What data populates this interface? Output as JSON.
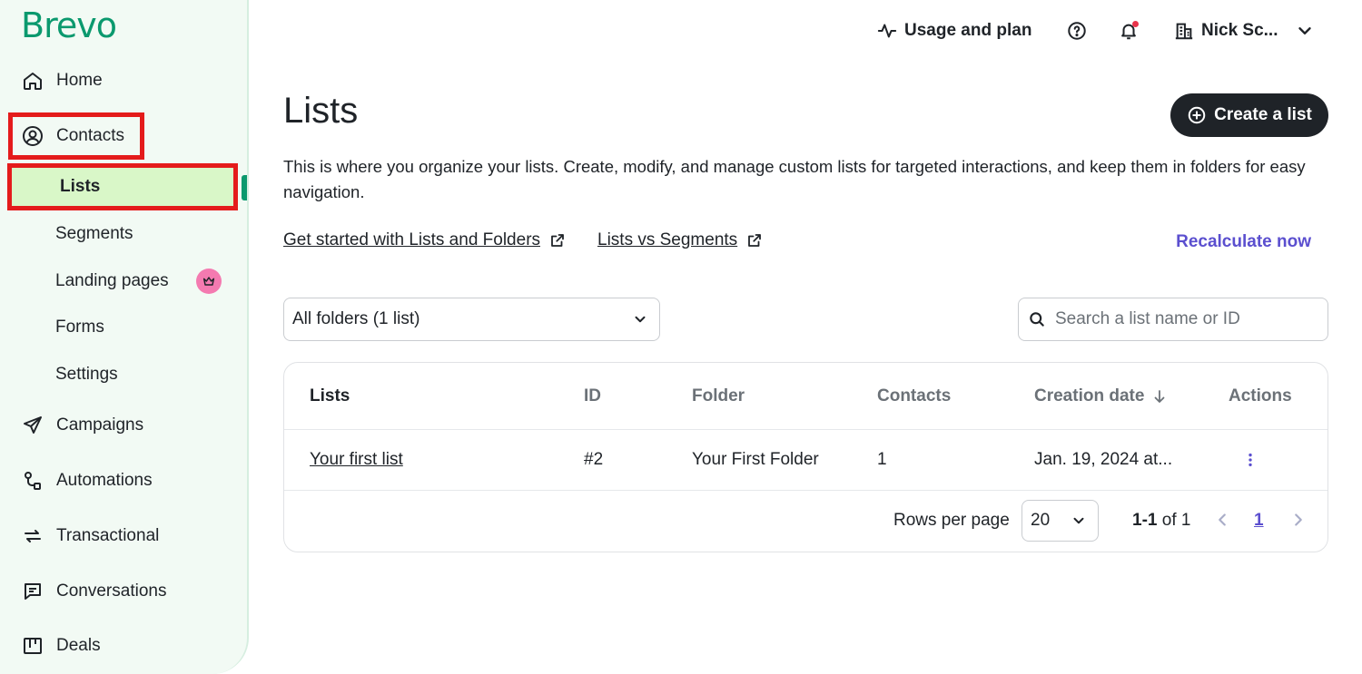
{
  "brand": {
    "logo_text": "Brevo"
  },
  "sidebar": {
    "items": [
      {
        "label": "Home"
      },
      {
        "label": "Contacts"
      },
      {
        "label": "Campaigns"
      },
      {
        "label": "Automations"
      },
      {
        "label": "Transactional"
      },
      {
        "label": "Conversations"
      },
      {
        "label": "Deals"
      }
    ],
    "contacts_sub": [
      {
        "label": "Lists"
      },
      {
        "label": "Segments"
      },
      {
        "label": "Landing pages"
      },
      {
        "label": "Forms"
      },
      {
        "label": "Settings"
      }
    ]
  },
  "header": {
    "usage_label": "Usage and plan",
    "account_name": "Nick Sc..."
  },
  "main": {
    "title": "Lists",
    "create_button": "Create a list",
    "description": "This is where you organize your lists. Create, modify, and manage custom lists for targeted interactions, and keep them in folders for easy navigation.",
    "links": {
      "get_started": "Get started with Lists and Folders",
      "lists_vs_segments": "Lists vs Segments",
      "recalculate": "Recalculate now"
    },
    "folder_select": "All folders (1 list)",
    "search_placeholder": "Search a list name or ID",
    "table": {
      "columns": [
        "Lists",
        "ID",
        "Folder",
        "Contacts",
        "Creation date",
        "Actions"
      ],
      "rows": [
        {
          "name": "Your first list",
          "id": "#2",
          "folder": "Your First Folder",
          "contacts": "1",
          "created": "Jan. 19, 2024 at..."
        }
      ]
    },
    "pagination": {
      "rows_per_page_label": "Rows per page",
      "rows_per_page_value": "20",
      "range_bold": "1-1",
      "range_rest": " of 1",
      "current_page": "1"
    }
  },
  "colors": {
    "brand_green": "#0b996e",
    "accent_purple": "#5b4fcf",
    "highlight_red": "#e41b1b",
    "active_item_bg": "#d9f7c8"
  }
}
